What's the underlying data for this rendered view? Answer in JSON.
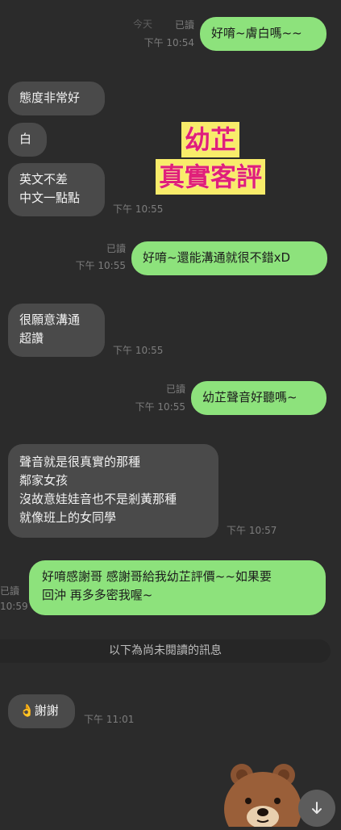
{
  "messages": [
    {
      "id": "m1",
      "dir": "out",
      "text": "好唷~膚白嗎~~",
      "read": "已讀",
      "time": "下午 10:54",
      "top_meta": "今天"
    },
    {
      "id": "m2",
      "dir": "in",
      "text": "態度非常好"
    },
    {
      "id": "m3",
      "dir": "in",
      "text": "白"
    },
    {
      "id": "m4",
      "dir": "in",
      "text": "英文不差\n中文一點點",
      "time": "下午 10:55"
    },
    {
      "id": "m5",
      "dir": "out",
      "text": "好唷~還能溝通就很不錯xD",
      "read": "已讀",
      "time": "下午 10:55"
    },
    {
      "id": "m6",
      "dir": "in",
      "text": "很願意溝通\n超讚",
      "time": "下午 10:55"
    },
    {
      "id": "m7",
      "dir": "out",
      "text": "幼芷聲音好聽嗎~",
      "read": "已讀",
      "time": "下午 10:55"
    },
    {
      "id": "m8",
      "dir": "in",
      "text": "聲音就是很真實的那種\n鄰家女孩\n沒故意娃娃音也不是剎黃那種\n就像班上的女同學",
      "time": "下午 10:57"
    },
    {
      "id": "m9",
      "dir": "out",
      "text": "好唷感謝哥 感謝哥給我幼芷評價~~如果要\n回沖 再多多密我喔~",
      "read": "已讀",
      "time": "10:59"
    },
    {
      "id": "m10",
      "dir": "in",
      "text": "👌謝謝",
      "time": "下午 11:01"
    }
  ],
  "sticker": {
    "line1": "幼芷",
    "line2": "真實客評"
  },
  "unread_divider": "以下為尚未閱讀的訊息",
  "icons": {
    "scroll": "arrow-down-icon",
    "bear": "brown-bear-sticker"
  }
}
